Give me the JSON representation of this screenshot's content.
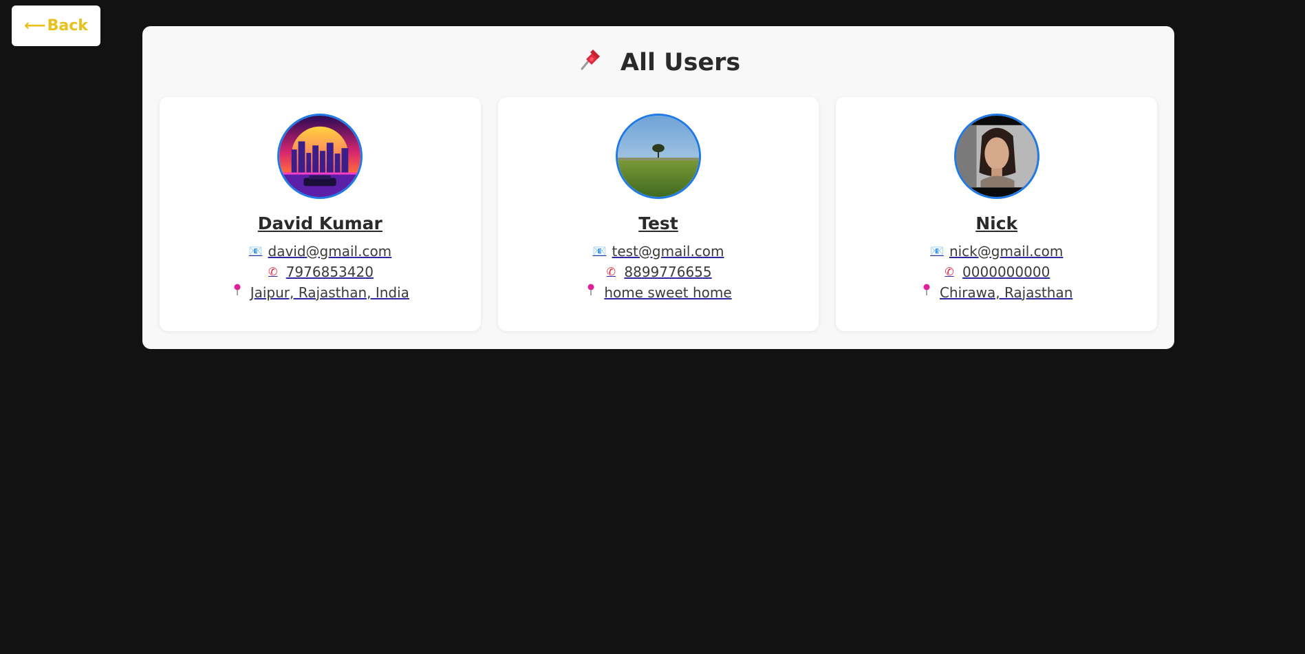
{
  "back_button": {
    "arrow": "⟵",
    "label": "Back"
  },
  "page": {
    "title": "All Users",
    "title_icon": "pin-icon"
  },
  "users": [
    {
      "name": "David Kumar",
      "email": "david@gmail.com",
      "phone": "7976853420",
      "location": "Jaipur, Rajasthan, India",
      "avatar": "synthwave-city-avatar"
    },
    {
      "name": "Test",
      "email": "test@gmail.com",
      "phone": "8899776655",
      "location": "home sweet home",
      "avatar": "tree-field-avatar"
    },
    {
      "name": "Nick",
      "email": "nick@gmail.com",
      "phone": "0000000000",
      "location": "Chirawa, Rajasthan",
      "avatar": "portrait-avatar"
    }
  ],
  "colors": {
    "background": "#121212",
    "panel": "#f8f8f8",
    "accent_yellow": "#e8c11a",
    "avatar_border": "#1f7ae8"
  }
}
